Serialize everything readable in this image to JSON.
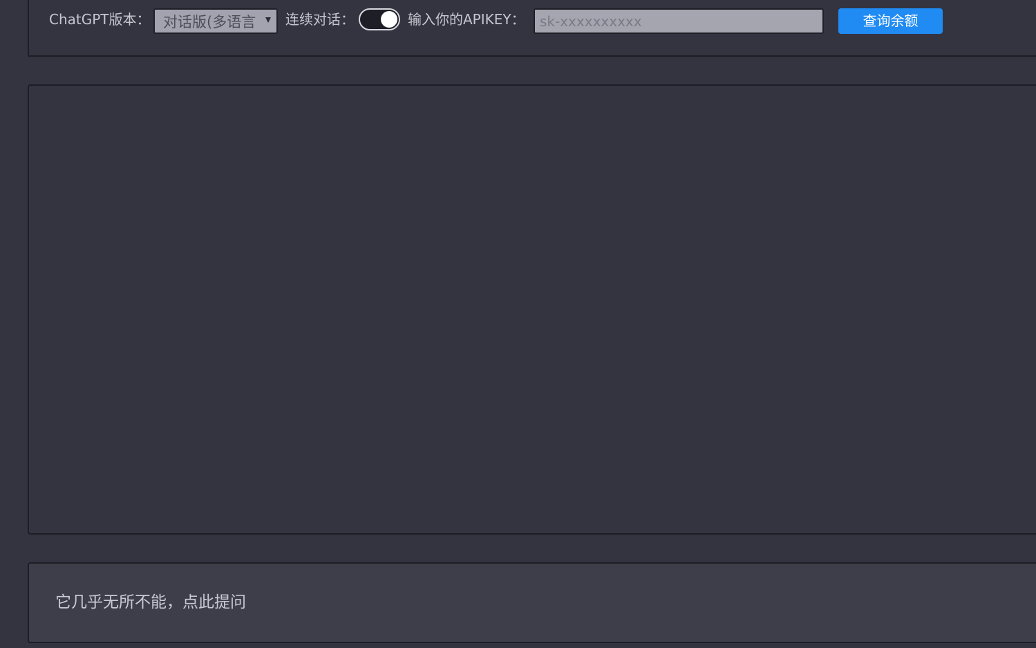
{
  "toolbar": {
    "version_label": "ChatGPT版本：",
    "version_select_value": "对话版(多语言)",
    "continuous_label": "连续对话：",
    "continuous_enabled": true,
    "apikey_label": "输入你的APIKEY：",
    "apikey_placeholder": "sk-xxxxxxxxxx",
    "balance_button": "查询余额"
  },
  "prompt": {
    "placeholder": "它几乎无所不能，点此提问"
  },
  "colors": {
    "background": "#343441",
    "accent_button": "#1f8bf3",
    "input_background": "#a5a5b0",
    "prompt_background": "#3e3e4b"
  }
}
